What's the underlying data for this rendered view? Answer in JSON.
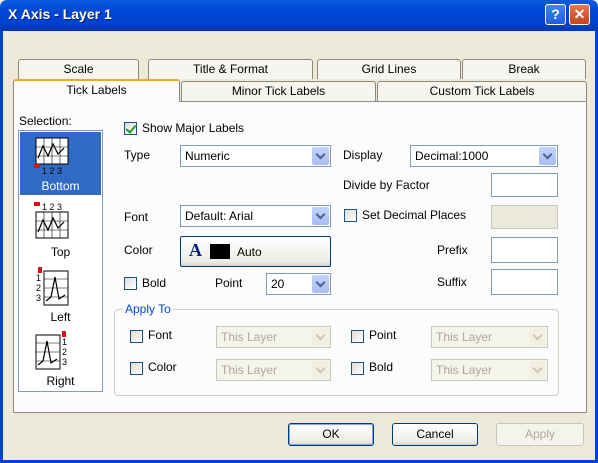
{
  "window": {
    "title": "X Axis - Layer 1",
    "help_glyph": "?",
    "close_glyph": "✕"
  },
  "tabs_row1": [
    {
      "label": "Scale"
    },
    {
      "label": "Title & Format"
    },
    {
      "label": "Grid Lines"
    },
    {
      "label": "Break"
    }
  ],
  "tabs_row2": [
    {
      "label": "Tick Labels",
      "active": true
    },
    {
      "label": "Minor Tick Labels"
    },
    {
      "label": "Custom Tick Labels"
    }
  ],
  "selection": {
    "label": "Selection:",
    "items": [
      {
        "label": "Bottom",
        "icon": "axis-bottom-icon",
        "selected": true
      },
      {
        "label": "Top",
        "icon": "axis-top-icon"
      },
      {
        "label": "Left",
        "icon": "axis-left-icon"
      },
      {
        "label": "Right",
        "icon": "axis-right-icon"
      }
    ]
  },
  "show_major_labels": {
    "label": "Show Major Labels",
    "checked": true
  },
  "type": {
    "label": "Type",
    "value": "Numeric"
  },
  "display": {
    "label": "Display",
    "value": "Decimal:1000"
  },
  "divide_by_factor": {
    "label": "Divide by Factor",
    "value": ""
  },
  "font": {
    "label": "Font",
    "value": "Default: Arial"
  },
  "set_decimal_places": {
    "label": "Set Decimal Places",
    "checked": false,
    "value": ""
  },
  "color": {
    "label": "Color",
    "glyph": "A",
    "value": "Auto",
    "swatch": "#000000"
  },
  "prefix": {
    "label": "Prefix",
    "value": ""
  },
  "suffix": {
    "label": "Suffix",
    "value": ""
  },
  "bold": {
    "label": "Bold",
    "checked": false
  },
  "point": {
    "label": "Point",
    "value": "20"
  },
  "apply_to": {
    "title": "Apply To",
    "font": {
      "label": "Font",
      "value": "This Layer"
    },
    "color": {
      "label": "Color",
      "value": "This Layer"
    },
    "point": {
      "label": "Point",
      "value": "This Layer"
    },
    "bold": {
      "label": "Bold",
      "value": "This Layer"
    }
  },
  "buttons": {
    "ok": "OK",
    "cancel": "Cancel",
    "apply": "Apply"
  },
  "colors": {
    "title_bar": "#0046d5",
    "selection_highlight": "#316ac5",
    "active_tab_accent": "#f3a629",
    "group_title": "#0046d5"
  }
}
